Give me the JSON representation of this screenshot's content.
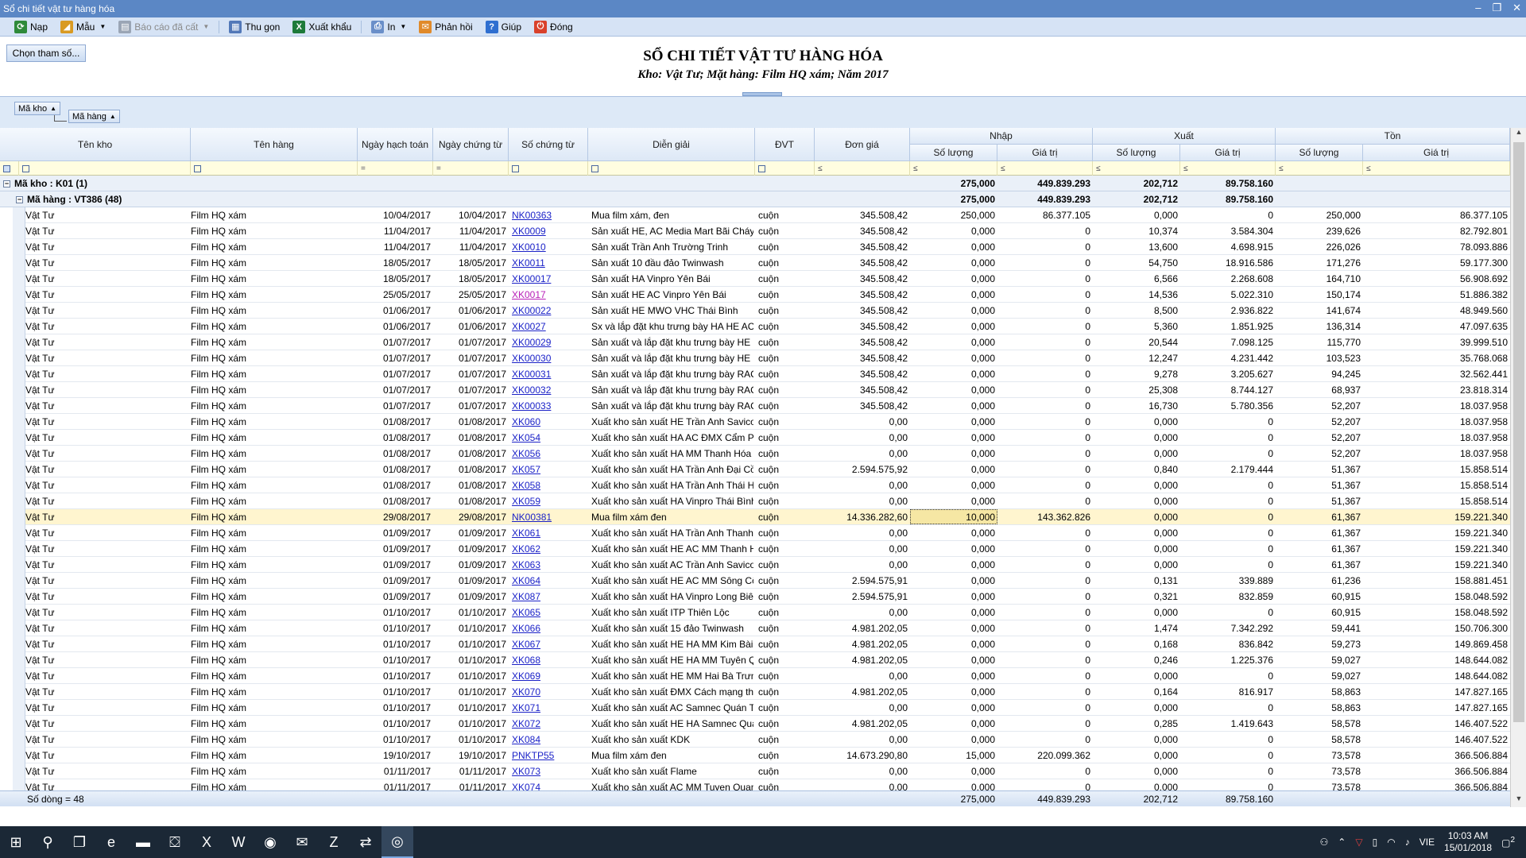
{
  "window": {
    "title": "Sổ chi tiết vật tư hàng hóa",
    "controls": [
      "–",
      "❐",
      "✕"
    ]
  },
  "toolbar": [
    {
      "label": "Nạp",
      "icon": "refresh-icon",
      "color": "#2f8a3a",
      "glyph": "⟳"
    },
    {
      "label": "Mẫu",
      "icon": "template-icon",
      "color": "#d99a22",
      "glyph": "◢",
      "dropdown": true
    },
    {
      "label": "Báo cáo đã cất",
      "icon": "saved-report-icon",
      "color": "#9aa5b5",
      "glyph": "▤",
      "dropdown": true,
      "disabled": true
    },
    {
      "label": "Thu gọn",
      "icon": "collapse-icon",
      "color": "#5278b8",
      "glyph": "▦"
    },
    {
      "label": "Xuất khẩu",
      "icon": "excel-export-icon",
      "color": "#1d7a3a",
      "glyph": "X"
    },
    {
      "label": "In",
      "icon": "print-icon",
      "color": "#6a8fc9",
      "glyph": "⎙",
      "dropdown": true
    },
    {
      "label": "Phản hồi",
      "icon": "feedback-icon",
      "color": "#e08a2a",
      "glyph": "✉"
    },
    {
      "label": "Giúp",
      "icon": "help-icon",
      "color": "#2f6fd0",
      "glyph": "?"
    },
    {
      "label": "Đóng",
      "icon": "close-report-icon",
      "color": "#d9412b",
      "glyph": "⏻"
    }
  ],
  "header": {
    "choose_button": "Chọn tham số...",
    "title": "SỔ CHI TIẾT VẬT TƯ HÀNG HÓA",
    "subtitle": "Kho: Vật Tư; Mặt hàng: Film HQ xám; Năm 2017"
  },
  "group_panel": {
    "chips": [
      "Mã kho",
      "Mã hàng"
    ]
  },
  "columns": {
    "ten_kho": "Tên kho",
    "ten_hang": "Tên hàng",
    "ngay_hach_toan": "Ngày hạch toán",
    "ngay_chung_tu": "Ngày chứng từ",
    "so_chung_tu": "Số chứng từ",
    "dien_giai": "Diễn giải",
    "dvt": "ĐVT",
    "don_gia": "Đơn giá",
    "nhap": "Nhập",
    "xuat": "Xuất",
    "ton": "Tồn",
    "so_luong": "Số lượng",
    "gia_tri": "Giá trị"
  },
  "filter_ops": {
    "eq": "=",
    "le": "≤"
  },
  "groups": {
    "kho": {
      "label": "Mã kho : K01 (1)",
      "nhap_sl": "275,000",
      "nhap_gt": "449.839.293",
      "xuat_sl": "202,712",
      "xuat_gt": "89.758.160"
    },
    "hang": {
      "label": "Mã hàng : VT386 (48)",
      "nhap_sl": "275,000",
      "nhap_gt": "449.839.293",
      "xuat_sl": "202,712",
      "xuat_gt": "89.758.160"
    }
  },
  "rows": [
    [
      "Vật Tư",
      "Film HQ xám",
      "10/04/2017",
      "10/04/2017",
      "NK00363",
      "Mua film xám, đen",
      "cuộn",
      "345.508,42",
      "250,000",
      "86.377.105",
      "0,000",
      "0",
      "250,000",
      "86.377.105"
    ],
    [
      "Vật Tư",
      "Film HQ xám",
      "11/04/2017",
      "11/04/2017",
      "XK0009",
      "Sản xuất HE, AC Media Mart Bãi Cháy",
      "cuộn",
      "345.508,42",
      "0,000",
      "0",
      "10,374",
      "3.584.304",
      "239,626",
      "82.792.801"
    ],
    [
      "Vật Tư",
      "Film HQ xám",
      "11/04/2017",
      "11/04/2017",
      "XK0010",
      "Sản xuất Trần Anh Trường Trinh",
      "cuộn",
      "345.508,42",
      "0,000",
      "0",
      "13,600",
      "4.698.915",
      "226,026",
      "78.093.886"
    ],
    [
      "Vật Tư",
      "Film HQ xám",
      "18/05/2017",
      "18/05/2017",
      "XK0011",
      "Sản xuất 10 đầu đảo Twinwash",
      "cuộn",
      "345.508,42",
      "0,000",
      "0",
      "54,750",
      "18.916.586",
      "171,276",
      "59.177.300"
    ],
    [
      "Vật Tư",
      "Film HQ xám",
      "18/05/2017",
      "18/05/2017",
      "XK00017",
      "Sản xuất HA Vinpro Yên Bái",
      "cuộn",
      "345.508,42",
      "0,000",
      "0",
      "6,566",
      "2.268.608",
      "164,710",
      "56.908.692"
    ],
    [
      "Vật Tư",
      "Film HQ xám",
      "25/05/2017",
      "25/05/2017",
      "XK0017",
      "Sản xuất HE AC Vinpro Yên Bái",
      "cuộn",
      "345.508,42",
      "0,000",
      "0",
      "14,536",
      "5.022.310",
      "150,174",
      "51.886.382"
    ],
    [
      "Vật Tư",
      "Film HQ xám",
      "01/06/2017",
      "01/06/2017",
      "XK00022",
      "Sản xuất HE MWO VHC Thái Bình",
      "cuộn",
      "345.508,42",
      "0,000",
      "0",
      "8,500",
      "2.936.822",
      "141,674",
      "48.949.560"
    ],
    [
      "Vật Tư",
      "Film HQ xám",
      "01/06/2017",
      "01/06/2017",
      "XK0027",
      "Sx và lắp đặt khu trưng bày HA HE AC",
      "cuộn",
      "345.508,42",
      "0,000",
      "0",
      "5,360",
      "1.851.925",
      "136,314",
      "47.097.635"
    ],
    [
      "Vật Tư",
      "Film HQ xám",
      "01/07/2017",
      "01/07/2017",
      "XK00029",
      "Sản xuất và lắp đặt khu trưng bày HE H",
      "cuộn",
      "345.508,42",
      "0,000",
      "0",
      "20,544",
      "7.098.125",
      "115,770",
      "39.999.510"
    ],
    [
      "Vật Tư",
      "Film HQ xám",
      "01/07/2017",
      "01/07/2017",
      "XK00030",
      "Sản xuất và lắp đặt khu trưng bày HE H",
      "cuộn",
      "345.508,42",
      "0,000",
      "0",
      "12,247",
      "4.231.442",
      "103,523",
      "35.768.068"
    ],
    [
      "Vật Tư",
      "Film HQ xám",
      "01/07/2017",
      "01/07/2017",
      "XK00031",
      "Sản xuất và lắp đặt khu trưng bày RAC",
      "cuộn",
      "345.508,42",
      "0,000",
      "0",
      "9,278",
      "3.205.627",
      "94,245",
      "32.562.441"
    ],
    [
      "Vật Tư",
      "Film HQ xám",
      "01/07/2017",
      "01/07/2017",
      "XK00032",
      "Sản xuất và lắp đặt khu trưng bày RAC",
      "cuộn",
      "345.508,42",
      "0,000",
      "0",
      "25,308",
      "8.744.127",
      "68,937",
      "23.818.314"
    ],
    [
      "Vật Tư",
      "Film HQ xám",
      "01/07/2017",
      "01/07/2017",
      "XK00033",
      "Sản xuất và lắp đặt khu trưng bày RAC",
      "cuộn",
      "345.508,42",
      "0,000",
      "0",
      "16,730",
      "5.780.356",
      "52,207",
      "18.037.958"
    ],
    [
      "Vật Tư",
      "Film HQ xám",
      "01/08/2017",
      "01/08/2017",
      "XK060",
      "Xuất kho sản xuất HE Trần Anh Savico",
      "cuộn",
      "0,00",
      "0,000",
      "0",
      "0,000",
      "0",
      "52,207",
      "18.037.958"
    ],
    [
      "Vật Tư",
      "Film HQ xám",
      "01/08/2017",
      "01/08/2017",
      "XK054",
      "Xuất kho sản xuất HA AC ĐMX Cẩm Ph",
      "cuộn",
      "0,00",
      "0,000",
      "0",
      "0,000",
      "0",
      "52,207",
      "18.037.958"
    ],
    [
      "Vật Tư",
      "Film HQ xám",
      "01/08/2017",
      "01/08/2017",
      "XK056",
      "Xuất kho sản xuất HA MM Thanh Hóa 1",
      "cuộn",
      "0,00",
      "0,000",
      "0",
      "0,000",
      "0",
      "52,207",
      "18.037.958"
    ],
    [
      "Vật Tư",
      "Film HQ xám",
      "01/08/2017",
      "01/08/2017",
      "XK057",
      "Xuất kho sản xuất HA Trần Anh Đại Cồ",
      "cuộn",
      "2.594.575,92",
      "0,000",
      "0",
      "0,840",
      "2.179.444",
      "51,367",
      "15.858.514"
    ],
    [
      "Vật Tư",
      "Film HQ xám",
      "01/08/2017",
      "01/08/2017",
      "XK058",
      "Xuất kho sản xuất HA Trần Anh Thái Hà",
      "cuộn",
      "0,00",
      "0,000",
      "0",
      "0,000",
      "0",
      "51,367",
      "15.858.514"
    ],
    [
      "Vật Tư",
      "Film HQ xám",
      "01/08/2017",
      "01/08/2017",
      "XK059",
      "Xuất kho sản xuất HA Vinpro Thái Bình",
      "cuộn",
      "0,00",
      "0,000",
      "0",
      "0,000",
      "0",
      "51,367",
      "15.858.514"
    ],
    [
      "Vật Tư",
      "Film HQ xám",
      "29/08/2017",
      "29/08/2017",
      "NK00381",
      "Mua film xám đen",
      "cuộn",
      "14.336.282,60",
      "10,000",
      "143.362.826",
      "0,000",
      "0",
      "61,367",
      "159.221.340"
    ],
    [
      "Vật Tư",
      "Film HQ xám",
      "01/09/2017",
      "01/09/2017",
      "XK061",
      "Xuất kho sản xuất HA Trần Anh Thanh",
      "cuộn",
      "0,00",
      "0,000",
      "0",
      "0,000",
      "0",
      "61,367",
      "159.221.340"
    ],
    [
      "Vật Tư",
      "Film HQ xám",
      "01/09/2017",
      "01/09/2017",
      "XK062",
      "Xuất kho sản xuất HE AC MM Thanh H",
      "cuộn",
      "0,00",
      "0,000",
      "0",
      "0,000",
      "0",
      "61,367",
      "159.221.340"
    ],
    [
      "Vật Tư",
      "Film HQ xám",
      "01/09/2017",
      "01/09/2017",
      "XK063",
      "Xuất kho sản xuất AC Trần Anh Savico",
      "cuộn",
      "0,00",
      "0,000",
      "0",
      "0,000",
      "0",
      "61,367",
      "159.221.340"
    ],
    [
      "Vật Tư",
      "Film HQ xám",
      "01/09/2017",
      "01/09/2017",
      "XK064",
      "Xuất kho sản xuất HE AC MM Sông Cô",
      "cuộn",
      "2.594.575,91",
      "0,000",
      "0",
      "0,131",
      "339.889",
      "61,236",
      "158.881.451"
    ],
    [
      "Vật Tư",
      "Film HQ xám",
      "01/09/2017",
      "01/09/2017",
      "XK087",
      "Xuất kho sản xuất HA Vinpro Long Biên",
      "cuộn",
      "2.594.575,91",
      "0,000",
      "0",
      "0,321",
      "832.859",
      "60,915",
      "158.048.592"
    ],
    [
      "Vật Tư",
      "Film HQ xám",
      "01/10/2017",
      "01/10/2017",
      "XK065",
      "Xuất kho sản xuất ITP Thiên Lộc",
      "cuộn",
      "0,00",
      "0,000",
      "0",
      "0,000",
      "0",
      "60,915",
      "158.048.592"
    ],
    [
      "Vật Tư",
      "Film HQ xám",
      "01/10/2017",
      "01/10/2017",
      "XK066",
      "Xuất kho sản xuất 15 đảo Twinwash",
      "cuộn",
      "4.981.202,05",
      "0,000",
      "0",
      "1,474",
      "7.342.292",
      "59,441",
      "150.706.300"
    ],
    [
      "Vật Tư",
      "Film HQ xám",
      "01/10/2017",
      "01/10/2017",
      "XK067",
      "Xuất kho sản xuất HE HA MM Kim Bài",
      "cuộn",
      "4.981.202,05",
      "0,000",
      "0",
      "0,168",
      "836.842",
      "59,273",
      "149.869.458"
    ],
    [
      "Vật Tư",
      "Film HQ xám",
      "01/10/2017",
      "01/10/2017",
      "XK068",
      "Xuất kho sản xuất HE HA MM Tuyên Q",
      "cuộn",
      "4.981.202,05",
      "0,000",
      "0",
      "0,246",
      "1.225.376",
      "59,027",
      "148.644.082"
    ],
    [
      "Vật Tư",
      "Film HQ xám",
      "01/10/2017",
      "01/10/2017",
      "XK069",
      "Xuất kho sản xuất HE MM Hai Bà Trưng",
      "cuộn",
      "0,00",
      "0,000",
      "0",
      "0,000",
      "0",
      "59,027",
      "148.644.082"
    ],
    [
      "Vật Tư",
      "Film HQ xám",
      "01/10/2017",
      "01/10/2017",
      "XK070",
      "Xuất kho sản xuất ĐMX Cách mạng thá",
      "cuộn",
      "4.981.202,05",
      "0,000",
      "0",
      "0,164",
      "816.917",
      "58,863",
      "147.827.165"
    ],
    [
      "Vật Tư",
      "Film HQ xám",
      "01/10/2017",
      "01/10/2017",
      "XK071",
      "Xuất kho sản xuất AC Samnec Quán To",
      "cuộn",
      "0,00",
      "0,000",
      "0",
      "0,000",
      "0",
      "58,863",
      "147.827.165"
    ],
    [
      "Vật Tư",
      "Film HQ xám",
      "01/10/2017",
      "01/10/2017",
      "XK072",
      "Xuất kho sản xuất HE HA Samnec Quả",
      "cuộn",
      "4.981.202,05",
      "0,000",
      "0",
      "0,285",
      "1.419.643",
      "58,578",
      "146.407.522"
    ],
    [
      "Vật Tư",
      "Film HQ xám",
      "01/10/2017",
      "01/10/2017",
      "XK084",
      "Xuất kho sản xuất KDK",
      "cuộn",
      "0,00",
      "0,000",
      "0",
      "0,000",
      "0",
      "58,578",
      "146.407.522"
    ],
    [
      "Vật Tư",
      "Film HQ xám",
      "19/10/2017",
      "19/10/2017",
      "PNKTP55",
      "Mua film xám đen",
      "cuộn",
      "14.673.290,80",
      "15,000",
      "220.099.362",
      "0,000",
      "0",
      "73,578",
      "366.506.884"
    ],
    [
      "Vật Tư",
      "Film HQ xám",
      "01/11/2017",
      "01/11/2017",
      "XK073",
      "Xuất kho sản xuất Flame",
      "cuộn",
      "0,00",
      "0,000",
      "0",
      "0,000",
      "0",
      "73,578",
      "366.506.884"
    ],
    [
      "Vật Tư",
      "Film HQ xám",
      "01/11/2017",
      "01/11/2017",
      "XK074",
      "Xuất kho sản xuất AC MM Tuyen Quan",
      "cuộn",
      "0,00",
      "0,000",
      "0",
      "0,000",
      "0",
      "73,578",
      "366.506.884"
    ]
  ],
  "selected_row": 19,
  "visited_links": [
    "XK0017"
  ],
  "footer": {
    "count": "Số dòng = 48",
    "nhap_sl": "275,000",
    "nhap_gt": "449.839.293",
    "xuat_sl": "202,712",
    "xuat_gt": "89.758.160"
  },
  "taskbar": {
    "apps": [
      {
        "name": "start-icon",
        "glyph": "⊞"
      },
      {
        "name": "search-icon",
        "glyph": "⚲"
      },
      {
        "name": "task-view-icon",
        "glyph": "❐"
      },
      {
        "name": "edge-icon",
        "glyph": "e"
      },
      {
        "name": "file-explorer-icon",
        "glyph": "▬"
      },
      {
        "name": "store-icon",
        "glyph": "⛋"
      },
      {
        "name": "excel-icon",
        "glyph": "X"
      },
      {
        "name": "word-icon",
        "glyph": "W"
      },
      {
        "name": "app-green-icon",
        "glyph": "◉"
      },
      {
        "name": "mail-icon",
        "glyph": "✉"
      },
      {
        "name": "zalo-icon",
        "glyph": "Z"
      },
      {
        "name": "teamviewer-icon",
        "glyph": "⇄"
      },
      {
        "name": "chrome-icon",
        "glyph": "◎"
      }
    ],
    "active_app": 12,
    "lang": "VIE",
    "time": "10:03 AM",
    "date": "15/01/2018",
    "notifications": "2"
  }
}
